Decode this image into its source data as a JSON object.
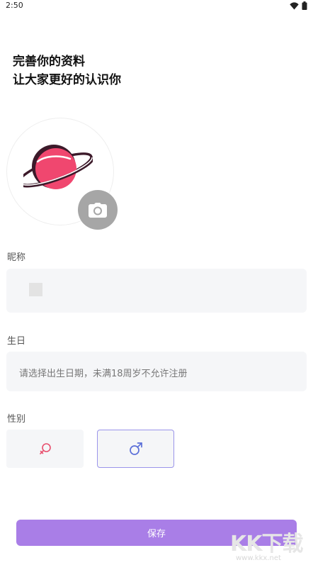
{
  "status_bar": {
    "time": "2:50",
    "icons": [
      "wifi-icon",
      "battery-icon"
    ]
  },
  "header": {
    "line1": "完善你的资料",
    "line2": "让大家更好的认识你"
  },
  "avatar": {
    "image": "planet-illustration",
    "upload_icon": "camera-icon"
  },
  "nickname": {
    "label": "昵称",
    "value": ""
  },
  "birthday": {
    "label": "生日",
    "placeholder": "请选择出生日期，未满18周岁不允许注册"
  },
  "gender": {
    "label": "性别",
    "options": [
      {
        "icon": "female-icon",
        "color": "#e8516f",
        "selected": false
      },
      {
        "icon": "male-icon",
        "color": "#5b6fd8",
        "selected": true
      }
    ]
  },
  "save_button": {
    "label": "保存",
    "color": "#a97ee7"
  },
  "watermark": {
    "logo": "KK下载",
    "url": "www.kkx.net"
  }
}
